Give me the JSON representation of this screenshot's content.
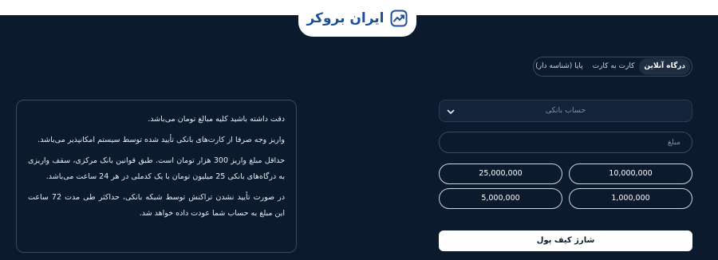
{
  "logo": {
    "text": "ایران بروکر",
    "icon": "trend-chart-icon",
    "color": "#1d4f91"
  },
  "tabs": [
    {
      "label": "درگاه آنلاین",
      "active": true
    },
    {
      "label": "کارت به کارت",
      "active": false
    },
    {
      "label": "پایا (شناسه دار)",
      "active": false
    }
  ],
  "notice": {
    "paragraphs": [
      "دقت داشته باشید کلیه مبالغ تومان می‌باشد.",
      "واریز وجه صرفا از کارت‌های بانکی تأیید شده توسط سیستم امکانپذیر می‌باشد.",
      "حداقل مبلغ واریز 300 هزار تومان است. طبق قوانین بانک مرکزی، سقف واریزی به درگاه‌های بانکی 25 میلیون تومان با یک کدملی در هر 24 ساعت می‌باشد.",
      "در صورت تأیید نشدن تراکنش توسط شبکه بانکی، حداکثر طی مدت 72 ساعت این مبلغ به حساب شما عودت داده خواهد شد."
    ]
  },
  "form": {
    "bank_account_placeholder": "حساب بانکی",
    "amount_placeholder": "مبلغ",
    "presets": [
      "10,000,000",
      "25,000,000",
      "1,000,000",
      "5,000,000"
    ],
    "submit_label": "شارژ کیف پول"
  },
  "colors": {
    "background": "#0b1a2c",
    "border": "#3a4a5f",
    "accent": "#1d4f91"
  }
}
